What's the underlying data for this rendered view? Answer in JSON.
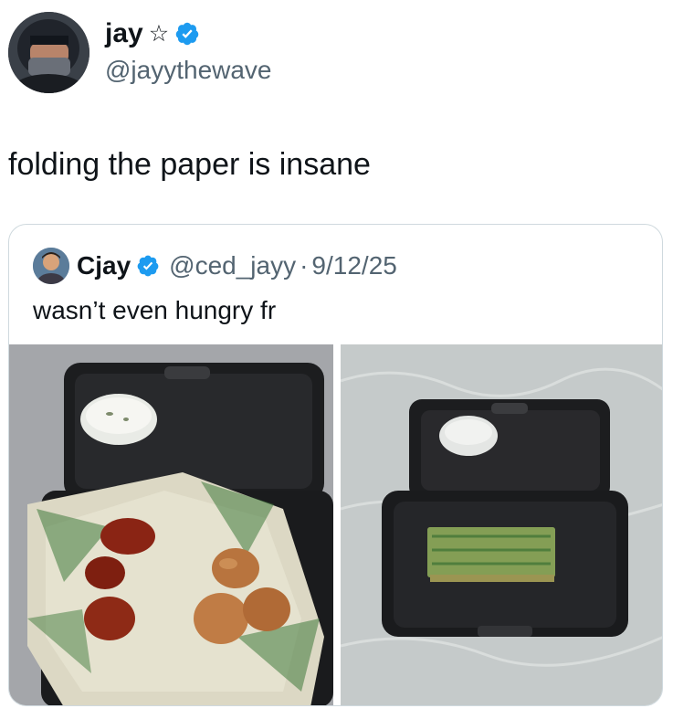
{
  "tweet": {
    "author_name": "jay",
    "author_star": "☆",
    "author_handle": "@jayythewave",
    "text": "folding the paper is insane"
  },
  "quote": {
    "author_name": "Cjay",
    "author_handle": "@ced_jayy",
    "separator": "·",
    "date": "9/12/25",
    "text": "wasn’t even hungry fr"
  },
  "icons": {
    "verified": "verified-badge-icon",
    "star": "star-outline-icon"
  },
  "colors": {
    "verified_blue": "#1d9bf0",
    "secondary_text": "#536471",
    "card_border": "#cfd9de"
  }
}
